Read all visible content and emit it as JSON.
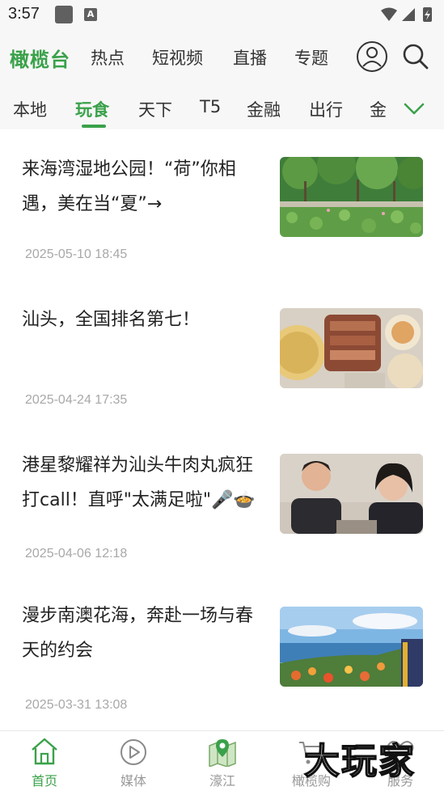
{
  "status_bar": {
    "time": "3:57"
  },
  "top_nav": {
    "brand": "橄榄台",
    "items": [
      {
        "label": "热点"
      },
      {
        "label": "短视频"
      },
      {
        "label": "直播"
      },
      {
        "label": "专题"
      }
    ],
    "icons": [
      "user-icon",
      "search-icon"
    ]
  },
  "channels": {
    "items": [
      {
        "label": "本地"
      },
      {
        "label": "玩食"
      },
      {
        "label": "天下"
      },
      {
        "label": "T5"
      },
      {
        "label": "金融"
      },
      {
        "label": "出行"
      },
      {
        "label": "金"
      }
    ],
    "active": "玩食",
    "accent_color": "#3aa14a"
  },
  "articles": [
    {
      "title": "来海湾湿地公园！“荷”你相遇，美在当“夏”→",
      "time": "2025-05-10 18:45"
    },
    {
      "title": "汕头，全国排名第七！",
      "time": "2025-04-24 17:35"
    },
    {
      "title": "港星黎耀祥为汕头牛肉丸疯狂打call！直呼\"太满足啦\"🎤🍲",
      "time": "2025-04-06 12:18"
    },
    {
      "title": "漫步南澳花海，奔赴一场与春天的约会",
      "time": "2025-03-31 13:08"
    }
  ],
  "tab_bar": {
    "items": [
      {
        "label": "首页",
        "icon": "home-icon"
      },
      {
        "label": "媒体",
        "icon": "play-icon"
      },
      {
        "label": "濠江",
        "icon": "map-icon"
      },
      {
        "label": "橄榄购",
        "icon": "cart-icon"
      },
      {
        "label": "服务",
        "icon": "heart-icon"
      }
    ],
    "active": "首页"
  },
  "watermark": "大玩家"
}
